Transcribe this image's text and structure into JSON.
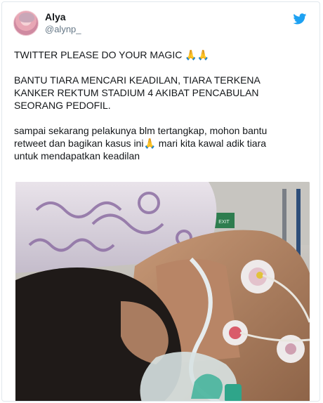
{
  "tweet": {
    "author": {
      "display_name": "Alya",
      "handle": "@alynp_"
    },
    "platform_icon": "twitter-bird-icon",
    "paragraphs": [
      "TWITTER PLEASE DO YOUR MAGIC 🙏🙏",
      "BANTU TIARA MENCARI KEADILAN, TIARA TERKENA\nKANKER REKTUM STADIUM 4 AKIBAT PENCABULAN\nSEORANG PEDOFIL.",
      "sampai sekarang pelakunya blm tertangkap, mohon bantu\nretweet dan  bagikan kasus ini🙏 mari kita kawal adik tiara\nuntuk mendapatkan keadilan"
    ],
    "media_sign_text": "EXIT"
  },
  "colors": {
    "twitter_blue": "#1da1f2",
    "text": "#14171a",
    "secondary_text": "#657786",
    "border": "#e1e8ed"
  }
}
